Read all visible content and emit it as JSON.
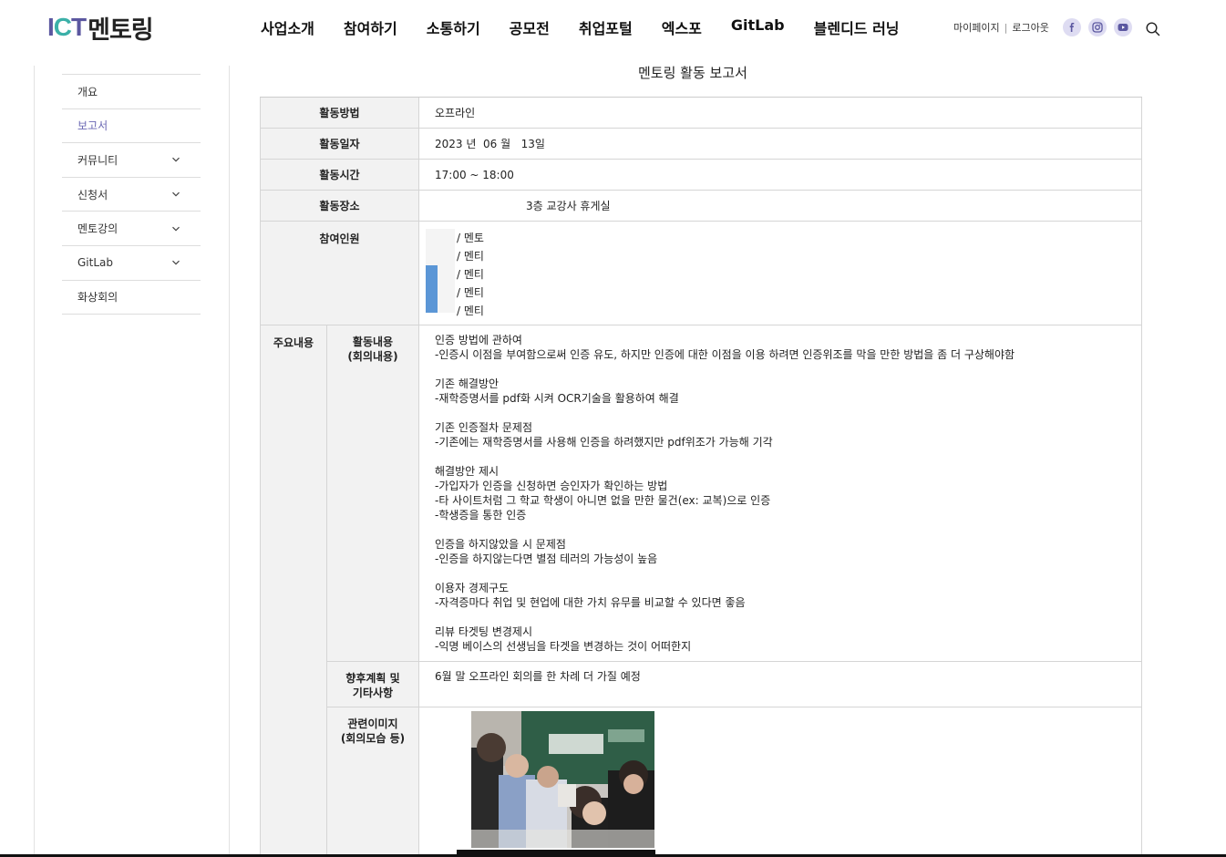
{
  "header": {
    "logo_ict": "ICT",
    "logo_text": "멘토링",
    "nav": [
      "사업소개",
      "참여하기",
      "소통하기",
      "공모전",
      "취업포털",
      "엑스포",
      "GitLab",
      "블렌디드 러닝"
    ],
    "mypage": "마이페이지",
    "separator": "|",
    "logout": "로그아웃",
    "sns_icons": [
      "facebook-icon",
      "instagram-icon",
      "youtube-icon"
    ]
  },
  "sidebar": {
    "items": [
      {
        "label": "개요",
        "expandable": false,
        "active": false
      },
      {
        "label": "보고서",
        "expandable": false,
        "active": true
      },
      {
        "label": "커뮤니티",
        "expandable": true,
        "active": false
      },
      {
        "label": "신청서",
        "expandable": true,
        "active": false
      },
      {
        "label": "멘토강의",
        "expandable": true,
        "active": false
      },
      {
        "label": "GitLab",
        "expandable": true,
        "active": false
      },
      {
        "label": "화상회의",
        "expandable": false,
        "active": false
      }
    ]
  },
  "report": {
    "title": "멘토링 활동 보고서",
    "method_label": "활동방법",
    "method_value": "오프라인",
    "date_label": "활동일자",
    "date_value": "2023 년  06 월   13일",
    "time_label": "활동시간",
    "time_value": "17:00 ~ 18:00",
    "place_label": "활동장소",
    "place_value": "3층 교강사 휴게실",
    "participants_label": "참여인원",
    "participants": [
      "/ 멘토",
      "/ 멘티",
      "/ 멘티",
      "/ 멘티",
      "/ 멘티"
    ],
    "main_label": "주요내용",
    "content_label_1": "활동내용",
    "content_label_2": "(회의내용)",
    "content_paragraphs": [
      [
        "인증 방법에 관하여",
        "-인증시 이점을 부여함으로써 인증 유도, 하지만 인증에 대한 이점을 이용 하려면 인증위조를 막을 만한 방법을 좀 더 구상해야함"
      ],
      [
        "기존 해결방안",
        "-재학증명서를 pdf화 시켜 OCR기술을 활용하여 해결"
      ],
      [
        "기존 인증절차 문제점",
        "-기존에는 재학증명서를 사용해 인증을 하려했지만 pdf위조가 가능해 기각"
      ],
      [
        "해결방안 제시",
        "-가입자가 인증을 신청하면 승인자가 확인하는 방법",
        "-타 사이트처럼 그 학교 학생이 아니면 없을 만한 물건(ex: 교복)으로 인증",
        "-학생증을 통한 인증"
      ],
      [
        "인증을 하지않았을 시 문제점",
        "-인증을 하지않는다면 별점 테러의 가능성이 높음"
      ],
      [
        "이용자 경제구도",
        "-자격증마다 취업 및 현업에 대한 가치 유무를 비교할 수 있다면 좋음"
      ],
      [
        "리뷰 타겟팅 변경제시",
        "-익명 베이스의 선생님을 타겟을 변경하는 것이 어떠한지"
      ]
    ],
    "plan_label_1": "향후계획 및",
    "plan_label_2": "기타사항",
    "plan_value": "6월 말 오프라인 회의를 한 차례 더 가질 예정",
    "image_label_1": "관련이미지",
    "image_label_2": "(회의모습 등)"
  },
  "colors": {
    "brand_purple": "#5b57a0",
    "brand_teal": "#3bb0a8",
    "active_sidebar": "#6a67b3",
    "table_header_bg": "#f2f2f2"
  }
}
